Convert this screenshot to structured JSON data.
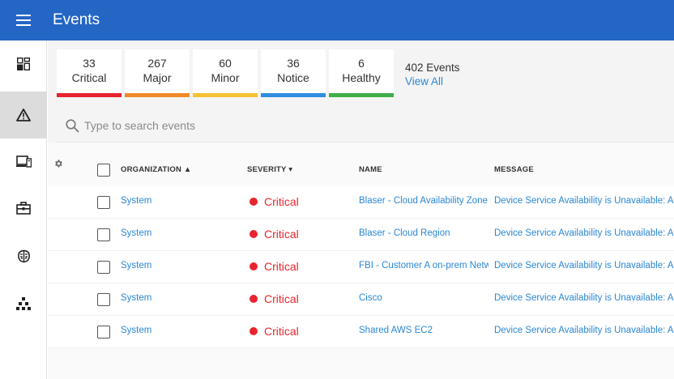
{
  "header": {
    "title": "Events"
  },
  "sidebar": {
    "items": [
      {
        "name": "dashboard-icon",
        "active": false
      },
      {
        "name": "alert-triangle-icon",
        "active": true
      },
      {
        "name": "devices-icon",
        "active": false
      },
      {
        "name": "briefcase-icon",
        "active": false
      },
      {
        "name": "brain-icon",
        "active": false
      },
      {
        "name": "topology-icon",
        "active": false
      }
    ]
  },
  "summary": {
    "cards": [
      {
        "count": "33",
        "label": "Critical",
        "color": "#e8242d"
      },
      {
        "count": "267",
        "label": "Major",
        "color": "#f08a28"
      },
      {
        "count": "60",
        "label": "Minor",
        "color": "#f5c232"
      },
      {
        "count": "36",
        "label": "Notice",
        "color": "#2f8ee0"
      },
      {
        "count": "6",
        "label": "Healthy",
        "color": "#3fae49"
      }
    ],
    "total": "402 Events",
    "view_all": "View All"
  },
  "search": {
    "placeholder": "Type to search events"
  },
  "table": {
    "columns": [
      {
        "label": "ORGANIZATION ▲"
      },
      {
        "label": "SEVERITY ▾"
      },
      {
        "label": "NAME"
      },
      {
        "label": "MESSAGE"
      }
    ],
    "rows": [
      {
        "organization": "System",
        "severity": "Critical",
        "name": "Blaser - Cloud Availability Zone",
        "message": "Device Service Availability is Unavailable: Azure"
      },
      {
        "organization": "System",
        "severity": "Critical",
        "name": "Blaser - Cloud Region",
        "message": "Device Service Availability is Unavailable: Azure"
      },
      {
        "organization": "System",
        "severity": "Critical",
        "name": "FBI - Customer A on-prem Network",
        "message": "Device Service Availability is Unavailable: Azure"
      },
      {
        "organization": "System",
        "severity": "Critical",
        "name": "Cisco",
        "message": "Device Service Availability is Unavailable: Azure"
      },
      {
        "organization": "System",
        "severity": "Critical",
        "name": "Shared AWS EC2",
        "message": "Device Service Availability is Unavailable: Azure"
      }
    ],
    "severity_color": "#e8242d"
  }
}
